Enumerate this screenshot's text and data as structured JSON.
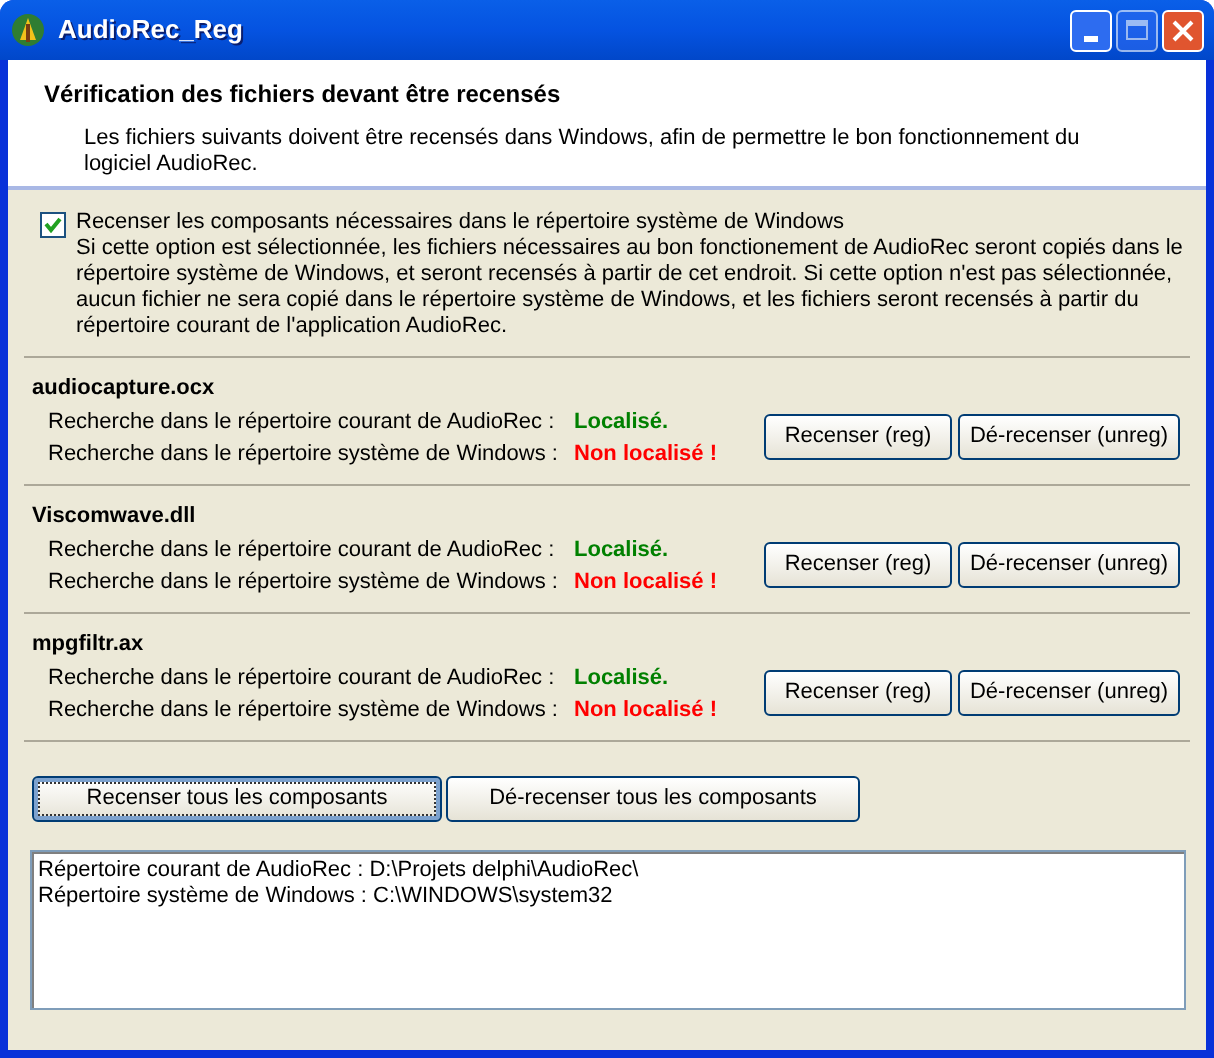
{
  "window": {
    "title": "AudioRec_Reg"
  },
  "header": {
    "title": "Vérification des fichiers devant être recensés",
    "description": "Les fichiers suivants doivent être recensés dans Windows, afin de permettre le bon fonctionnement du logiciel AudioRec."
  },
  "option": {
    "label": "Recenser les composants nécessaires dans le répertoire système de Windows",
    "checked": true,
    "description": "Si cette option est sélectionnée, les fichiers nécessaires au bon fonctionement de AudioRec seront copiés dans le répertoire système de Windows, et seront recensés à partir de cet endroit. Si cette option n'est pas sélectionnée, aucun fichier ne sera copié dans le répertoire système de Windows, et les fichiers seront recensés à partir du répertoire courant de l'application AudioRec."
  },
  "components": [
    {
      "name": "audiocapture.ocx",
      "checks": [
        {
          "label": "Recherche dans le répertoire courant de AudioRec :",
          "status": "Localisé.",
          "found": true
        },
        {
          "label": "Recherche dans le répertoire système de Windows :",
          "status": "Non localisé !",
          "found": false
        }
      ],
      "buttons": [
        "Recenser (reg)",
        "Dé-recenser (unreg)"
      ]
    },
    {
      "name": "Viscomwave.dll",
      "checks": [
        {
          "label": "Recherche dans le répertoire courant de AudioRec :",
          "status": "Localisé.",
          "found": true
        },
        {
          "label": "Recherche dans le répertoire système de Windows :",
          "status": "Non localisé !",
          "found": false
        }
      ],
      "buttons": [
        "Recenser (reg)",
        "Dé-recenser (unreg)"
      ]
    },
    {
      "name": "mpgfiltr.ax",
      "checks": [
        {
          "label": "Recherche dans le répertoire courant de AudioRec :",
          "status": "Localisé.",
          "found": true
        },
        {
          "label": "Recherche dans le répertoire système de Windows :",
          "status": "Non localisé !",
          "found": false
        }
      ],
      "buttons": [
        "Recenser (reg)",
        "Dé-recenser (unreg)"
      ]
    }
  ],
  "global_buttons": [
    {
      "label": "Recenser tous les composants",
      "focused": true
    },
    {
      "label": "Dé-recenser tous les composants",
      "focused": false
    }
  ],
  "log": [
    "Répertoire courant de AudioRec : D:\\Projets delphi\\AudioRec\\",
    "Répertoire système de Windows : C:\\WINDOWS\\system32"
  ]
}
